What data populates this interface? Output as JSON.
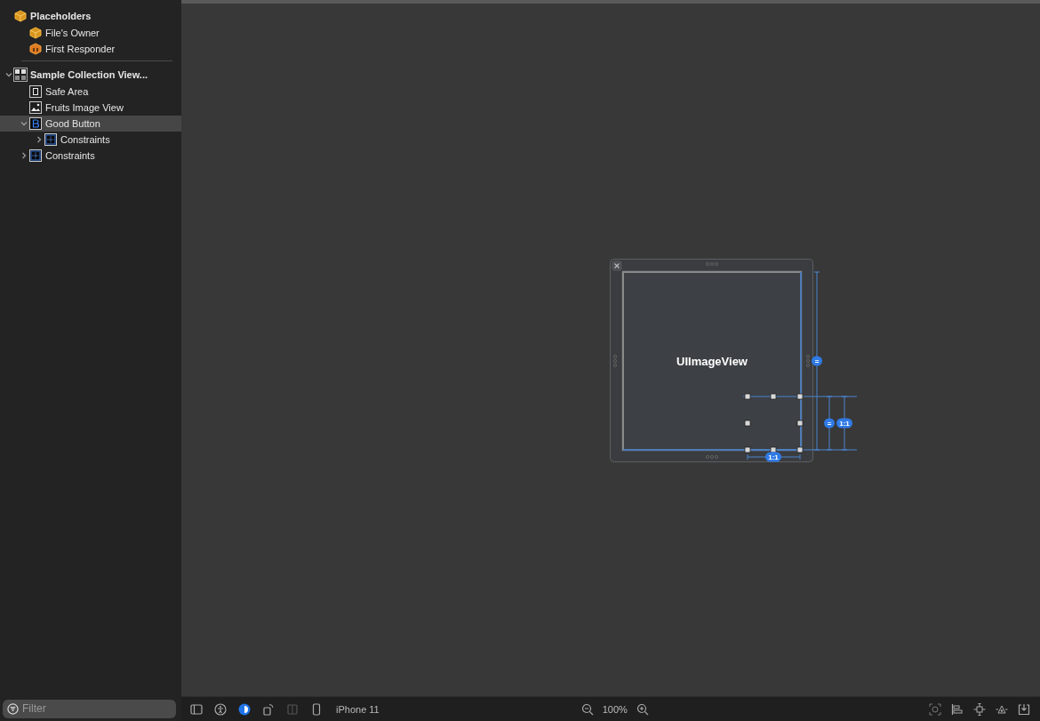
{
  "outline": [
    {
      "label": "Placeholders",
      "kind": "placeholder",
      "header": true,
      "selected": false,
      "children": [
        {
          "label": "File's Owner",
          "kind": "placeholder",
          "selected": false
        },
        {
          "label": "First Responder",
          "kind": "responder",
          "selected": false
        }
      ]
    },
    {
      "label": "Sample Collection View...",
      "kind": "view",
      "header": true,
      "expanded": true,
      "selected": false,
      "children": [
        {
          "label": "Safe Area",
          "kind": "safe-area",
          "selected": false
        },
        {
          "label": "Fruits Image View",
          "kind": "image",
          "selected": false
        },
        {
          "label": "Good Button",
          "kind": "button",
          "expanded": true,
          "selected": true,
          "children": [
            {
              "label": "Constraints",
              "kind": "constraints",
              "expanded": false,
              "selected": false
            }
          ]
        },
        {
          "label": "Constraints",
          "kind": "constraints",
          "expanded": false,
          "selected": false
        }
      ]
    }
  ],
  "canvas": {
    "view_label": "UIImageView",
    "badges": [
      {
        "text": "=",
        "kind": "height-equal"
      },
      {
        "text": "=",
        "kind": "button-equal"
      },
      {
        "text": "1:1",
        "kind": "button-ratio"
      },
      {
        "text": "1:1",
        "kind": "width-ratio"
      }
    ]
  },
  "filter": {
    "placeholder": "Filter"
  },
  "toolbar": {
    "device": "iPhone 11",
    "zoom": "100%"
  }
}
